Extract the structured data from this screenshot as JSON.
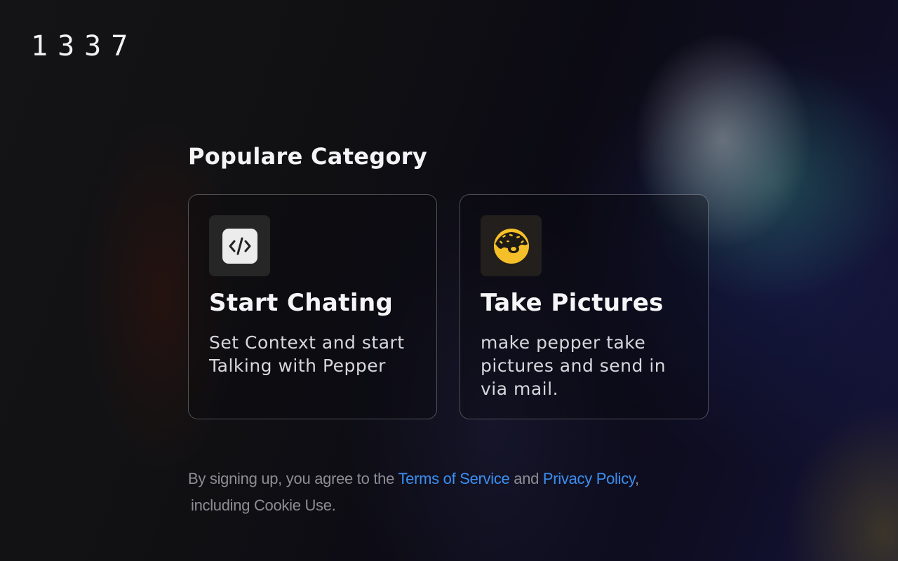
{
  "brand": {
    "logo_text": "1337"
  },
  "main": {
    "section_title": "Populare Category",
    "cards": [
      {
        "title": "Start Chating",
        "description": "Set Context and start Talking with Pepper",
        "icon": "code-icon"
      },
      {
        "title": "Take Pictures",
        "description": "make pepper take pictures and send in via mail.",
        "icon": "donut-icon"
      }
    ]
  },
  "legal": {
    "prefix": "By signing up, you agree to the ",
    "terms_link": "Terms of Service",
    "conjunction": " and ",
    "privacy_link": "Privacy Policy",
    "comma": ",",
    "suffix": "including Cookie Use."
  },
  "colors": {
    "link": "#3b8ff0",
    "donut": "#f5bf2a",
    "text_muted": "#8d8d94"
  }
}
